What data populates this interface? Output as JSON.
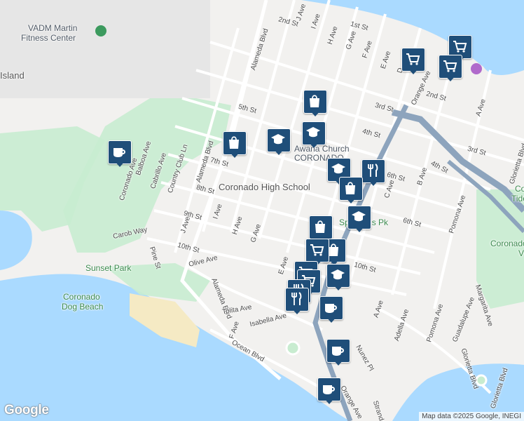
{
  "map": {
    "place_labels": {
      "vadm_line1": "VADM Martin",
      "vadm_line2": "Fitness Center",
      "island": "Island",
      "coronado_high": "Coronado High School",
      "church": "Awana Church",
      "church2": "CORONADO",
      "sunset_park": "Sunset Park",
      "dog_beach_1": "Coronado",
      "dog_beach_2": "Dog Beach",
      "parks": "Spreckels Pk",
      "tidel": "Co",
      "tidel2": "Tide",
      "coronado_right": "Coronado",
      "coronado_right2": "V"
    },
    "streets": {
      "alameda_blvd_top": "Alameda Blvd",
      "alameda_blvd_mid": "Alameda Blvd",
      "alameda_blvd_low": "Alameda Blvd",
      "first_st": "1st St",
      "second_st": "2nd St",
      "second_st_right": "2nd St",
      "third_st": "3rd St",
      "third_st_right": "3rd St",
      "fourth_st": "4th St",
      "fourth_st_right": "4th St",
      "fifth_st": "5th St",
      "sixth_st": "6th St",
      "sixth_st_b": "6th St",
      "seventh_st": "7th St",
      "eighth_st": "8th St",
      "ninth_st": "9th St",
      "tenth_st": "10th St",
      "tenth_st_b": "10th St",
      "j_ave_top": "J Ave",
      "i_ave_top": "I Ave",
      "h_ave_top": "H Ave",
      "g_ave_top": "G Ave",
      "f_ave_top": "F Ave",
      "e_ave_top": "E Ave",
      "d_ave_top": "D",
      "orange_ave": "Orange Ave",
      "orange_ave_low": "Orange Ave",
      "j_ave": "J Ave",
      "i_ave": "I Ave",
      "h_ave": "H Ave",
      "g_ave": "G Ave",
      "e_ave": "E Ave",
      "f_ave": "F Ave",
      "c_ave": "C Ave",
      "b_ave": "B Ave",
      "a_ave": "A Ave",
      "a_ave_low": "A Ave",
      "pomona_ave": "Pomona Ave",
      "pomona_ave_low": "Pomona Ave",
      "margarita_ave": "Margarita Ave",
      "guadalupe_ave": "Guadalupe Ave",
      "glorietta_blvd": "Glorietta Blvd",
      "glorietta_blvd_2": "Glorietta Blvd",
      "glorietta_blvd_top": "Glorietta Blvd",
      "adella_ave": "Adella Ave",
      "olive_ave": "Olive Ave",
      "carob_way": "Carob Way",
      "pine_st": "Pine St",
      "tolita_ave": "Tolita Ave",
      "isabella_ave": "Isabella Ave",
      "ocean_blvd": "Ocean Blvd",
      "coronado_ave": "Coronado Ave",
      "balboa_ave": "Balboa Ave",
      "cabrillo_ave": "Cabrillo Ave",
      "country_club_ln": "Country Club Ln",
      "nunez_pl": "Nunez Pl",
      "strand": "Strand",
      "tenth_e": "St",
      "tenth_e2": "th St"
    },
    "markers": [
      {
        "name": "grocery-marker-1",
        "icon": "cart"
      },
      {
        "name": "grocery-marker-2",
        "icon": "cart"
      },
      {
        "name": "grocery-marker-3",
        "icon": "cart"
      },
      {
        "name": "shop-marker-1",
        "icon": "bag"
      },
      {
        "name": "shop-marker-2",
        "icon": "bag"
      },
      {
        "name": "school-marker-1",
        "icon": "school"
      },
      {
        "name": "school-marker-2",
        "icon": "school"
      },
      {
        "name": "cafe-marker-1",
        "icon": "cup"
      }
    ],
    "attribution": "Map data ©2025 Google, INEGI",
    "logo": "Google",
    "colors": {
      "water": "#aadaff",
      "park": "#c8ecd0",
      "beach": "#f5eac4",
      "land": "#f2f1ef",
      "road": "#ffffff",
      "highway": "#8da4bd",
      "marker": "#1f4e79"
    }
  }
}
